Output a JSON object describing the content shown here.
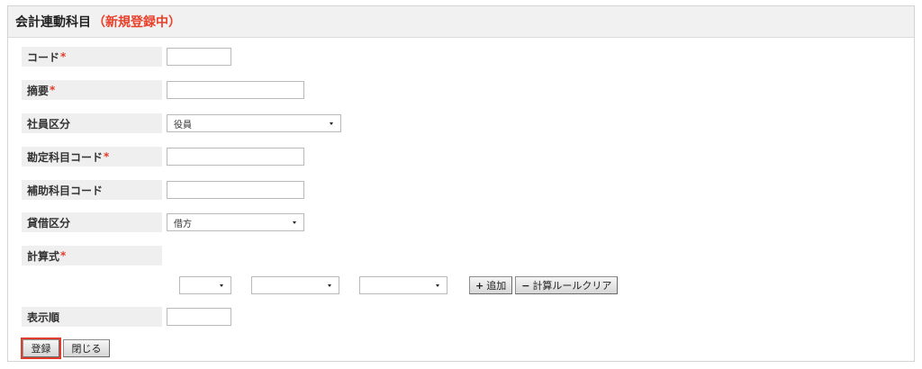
{
  "header": {
    "title": "会計連動科目",
    "status": "（新規登録中）"
  },
  "required_mark": "*",
  "fields": {
    "code": {
      "label": "コード",
      "value": ""
    },
    "summary": {
      "label": "摘要",
      "value": ""
    },
    "employee_category": {
      "label": "社員区分",
      "selected": "役員"
    },
    "account_code": {
      "label": "勘定科目コード",
      "value": ""
    },
    "sub_account_code": {
      "label": "補助科目コード",
      "value": ""
    },
    "debit_credit": {
      "label": "貸借区分",
      "selected": "借方"
    },
    "formula": {
      "label": "計算式",
      "select1": "",
      "select2": "",
      "select3": ""
    },
    "display_order": {
      "label": "表示順",
      "value": ""
    }
  },
  "formula_buttons": {
    "add_label": "追加",
    "clear_label": "計算ルールクリア"
  },
  "footer": {
    "register_label": "登録",
    "close_label": "閉じる"
  },
  "colors": {
    "required": "#e23b2b",
    "status": "#e8402a",
    "label_bg": "#efefef"
  }
}
